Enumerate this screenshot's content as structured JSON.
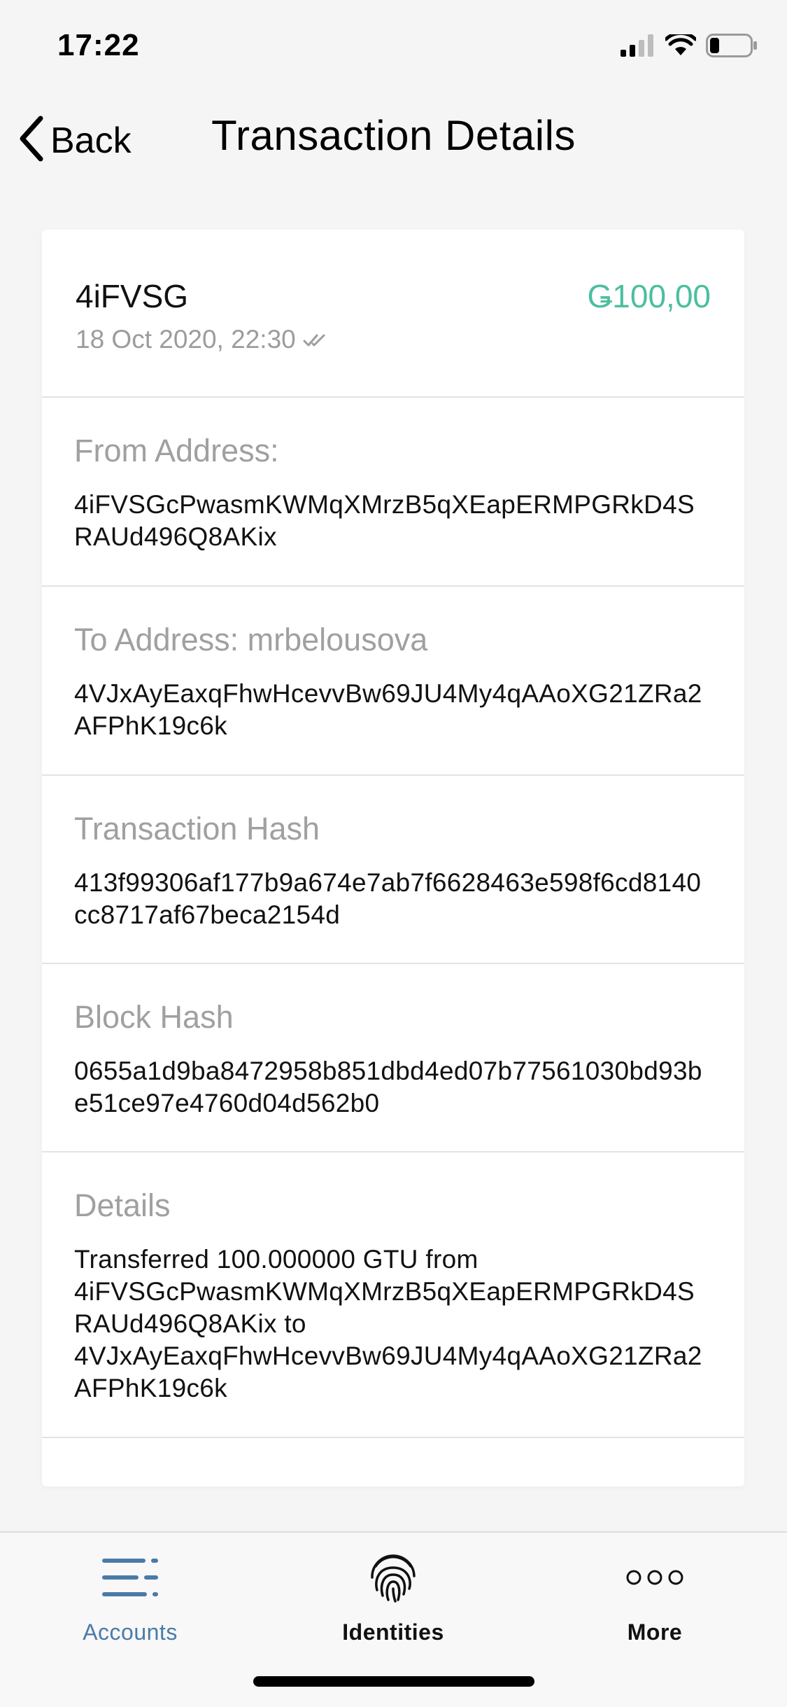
{
  "status_bar": {
    "time": "17:22"
  },
  "nav": {
    "back_label": "Back",
    "title": "Transaction Details"
  },
  "transaction": {
    "id": "4iFVSG",
    "amount": "Ǥ100,00",
    "date": "18 Oct 2020, 22:30",
    "status_icon": "double-check-icon"
  },
  "sections": {
    "from": {
      "label": "From Address:",
      "value": "4iFVSGcPwasmKWMqXMrzB5qXEapERMPGRkD4SRAUd496Q8AKix"
    },
    "to": {
      "label": "To Address: mrbelousova",
      "value": "4VJxAyEaxqFhwHcevvBw69JU4My4qAAoXG21ZRa2AFPhK19c6k"
    },
    "tx_hash": {
      "label": "Transaction Hash",
      "value": "413f99306af177b9a674e7ab7f6628463e598f6cd8140cc8717af67beca2154d"
    },
    "block_hash": {
      "label": "Block Hash",
      "value": "0655a1d9ba8472958b851dbd4ed07b77561030bd93be51ce97e4760d04d562b0"
    },
    "details": {
      "label": "Details",
      "line1": "Transferred 100.000000 GTU from",
      "line2": "4iFVSGcPwasmKWMqXMrzB5qXEapERMPGRkD4SRAUd496Q8AKix to",
      "line3": "4VJxAyEaxqFhwHcevvBw69JU4My4qAAoXG21ZRa2AFPhK19c6k"
    }
  },
  "tabs": [
    {
      "label": "Accounts",
      "icon": "accounts-list-icon",
      "active": true
    },
    {
      "label": "Identities",
      "icon": "fingerprint-icon",
      "active": false
    },
    {
      "label": "More",
      "icon": "more-dots-icon",
      "active": false
    }
  ],
  "colors": {
    "amount": "#4bbfa0",
    "active_tab": "#4a7ba8",
    "label_gray": "#a0a0a0"
  }
}
